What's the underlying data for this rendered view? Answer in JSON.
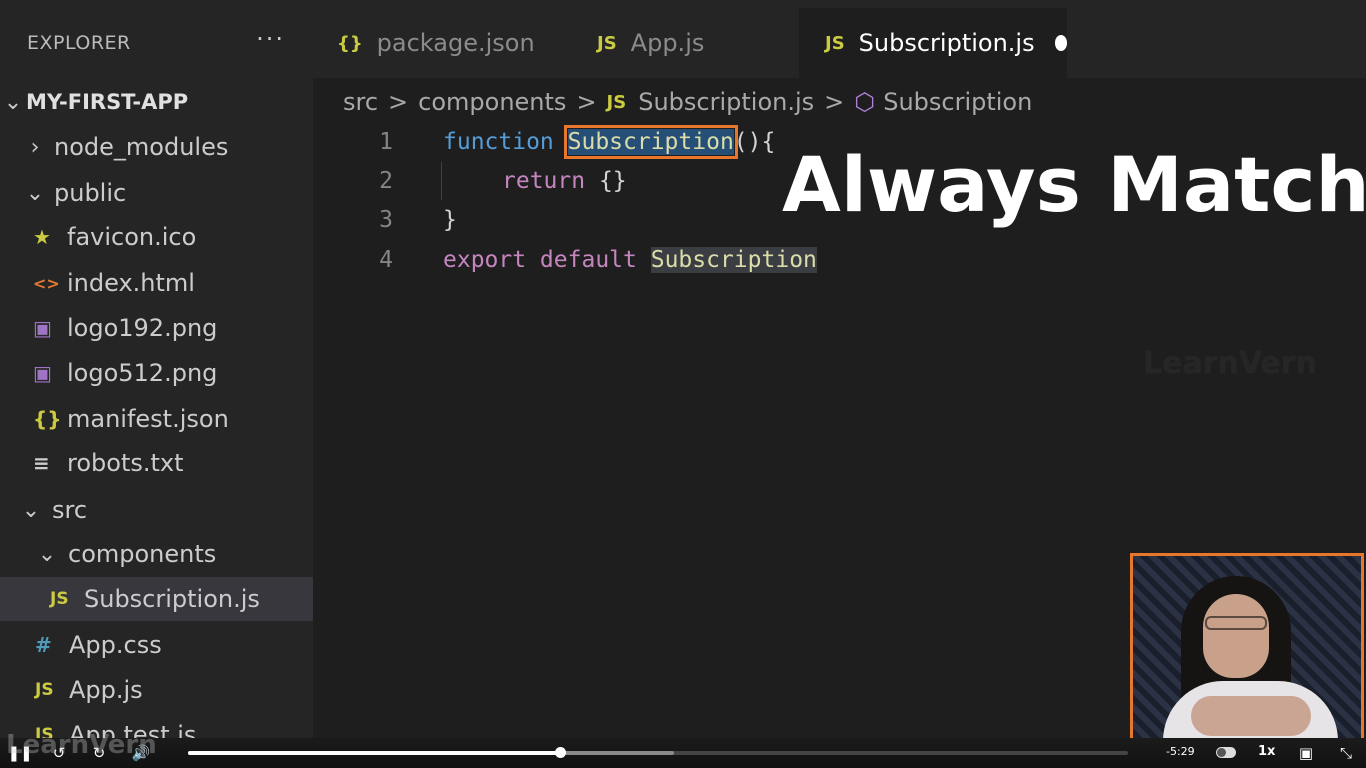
{
  "sidebar": {
    "title": "EXPLORER",
    "more": "···",
    "root": "MY-FIRST-APP",
    "items": [
      {
        "label": "node_modules",
        "chevron": "›",
        "icon": ""
      },
      {
        "label": "public",
        "chevron": "⌄",
        "icon": ""
      },
      {
        "label": "favicon.ico",
        "icon": "★"
      },
      {
        "label": "index.html",
        "icon": "<>"
      },
      {
        "label": "logo192.png",
        "icon": "▣"
      },
      {
        "label": "logo512.png",
        "icon": "▣"
      },
      {
        "label": "manifest.json",
        "icon": "{}"
      },
      {
        "label": "robots.txt",
        "icon": "≡"
      },
      {
        "label": "src",
        "chevron": "⌄",
        "icon": ""
      },
      {
        "label": "components",
        "chevron": "⌄",
        "icon": ""
      },
      {
        "label": "Subscription.js",
        "icon": "JS"
      },
      {
        "label": "App.css",
        "icon": "#"
      },
      {
        "label": "App.js",
        "icon": "JS"
      },
      {
        "label": "App.test.js",
        "icon": "JS"
      }
    ]
  },
  "tabs": [
    {
      "icon": "{}",
      "label": "package.json"
    },
    {
      "icon": "JS",
      "label": "App.js"
    },
    {
      "icon": "JS",
      "label": "Subscription.js"
    }
  ],
  "breadcrumb": {
    "parts": [
      "src",
      "components",
      "Subscription.js",
      "Subscription"
    ],
    "sep": ">",
    "js_icon": "JS"
  },
  "editor": {
    "line_numbers": [
      "1",
      "2",
      "3",
      "4"
    ],
    "l1": {
      "kw": "function ",
      "name": "Subscription",
      "rest": "(){"
    },
    "l2": {
      "kw": "return ",
      "rest": "{}"
    },
    "l3": {
      "rest": "}"
    },
    "l4": {
      "kw": "export default ",
      "name": "Subscription"
    }
  },
  "overlay": {
    "caption": "Always Match",
    "watermark": "LearnVern"
  },
  "player": {
    "time_left": "-5:29",
    "speed": "1x",
    "progress": 0.396,
    "buffered": 0.517,
    "brand": "LearnVern"
  },
  "colors": {
    "highlight_outline": "#e8762c",
    "selection": "#264f78",
    "keyword": "#569cd6",
    "function_name": "#dcdcaa"
  }
}
